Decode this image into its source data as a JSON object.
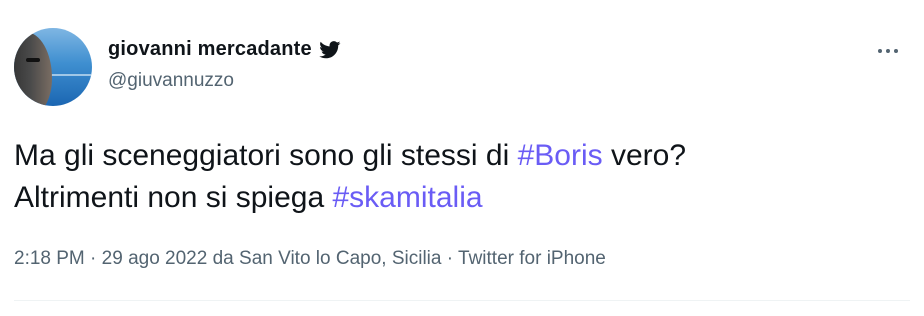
{
  "tweet": {
    "author_name": "giovanni mercadante",
    "author_handle": "@giuvannuzzo",
    "text_line1_prefix": "Ma gli sceneggiatori sono gli stessi di ",
    "hashtag1": "#Boris",
    "text_line1_suffix": " vero?",
    "text_line2_prefix": "Altrimenti non si spiega ",
    "hashtag2": "#skamitalia",
    "time": "2:18 PM",
    "sep1": " · ",
    "date": "29 ago 2022",
    "location_prefix": " da ",
    "location": "San Vito lo Capo, Sicilia",
    "sep2": " · ",
    "source": "Twitter for iPhone"
  },
  "icons": {
    "verified": "twitter-bird-icon",
    "more": "more-icon"
  },
  "colors": {
    "hashtag": "#6a5cf5",
    "secondary_text": "#536471",
    "primary_text": "#0f1419"
  }
}
